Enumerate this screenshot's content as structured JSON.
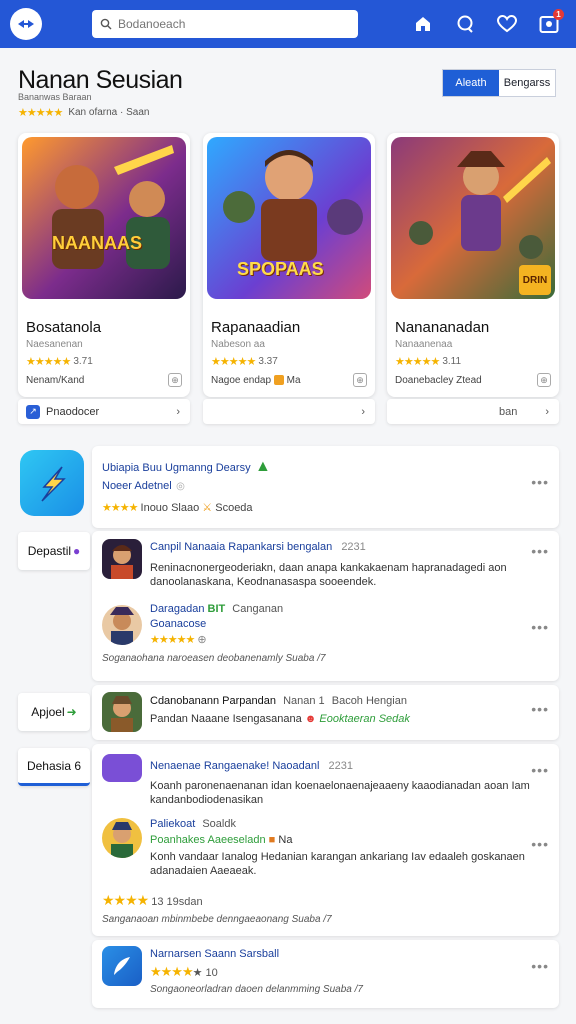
{
  "topbar": {
    "search_placeholder": "Bodanoeach",
    "notification_count": "1",
    "colors": {
      "bar": "#2457d6"
    }
  },
  "header": {
    "title": "Nanan Seusian",
    "subtitle": "Bananwas Baraan",
    "rating_text": "Kan ofarna · Saan",
    "toggle": {
      "active": "Aleath",
      "inactive": "Bengarss"
    }
  },
  "cards": [
    {
      "art_text": "NAANAAS",
      "title": "Bosatanola",
      "subtitle": "Naesanenan",
      "rating": "3.71",
      "meta": "Nenam/Kand",
      "stars": 4.5
    },
    {
      "art_text": "SPOPAAS",
      "title": "Rapanaadian",
      "subtitle": "Nabeson aa",
      "rating": "3.37",
      "meta": "Nagoe endap",
      "meta_extra": "Ma",
      "stars": 4.5
    },
    {
      "art_text": "DRIN",
      "title": "Nanananadan",
      "subtitle": "Nanaanenaa",
      "rating": "3.11",
      "meta": "Doanebacley Ztead",
      "stars": 4.5
    }
  ],
  "card_footers": [
    {
      "label": "Pnaodocer"
    },
    {
      "label": "ban"
    },
    {
      "label": ""
    }
  ],
  "side_labels": {
    "first": "Depastil",
    "second": "Apjoel",
    "third": "Dehasia 6"
  },
  "featured": {
    "line1": "Ubiapia Buu Ugmanng Dearsy",
    "line2": "Noeer Adetnel",
    "rating_text": "Inouo Slaao",
    "extra": "Scoeda"
  },
  "threads": [
    {
      "header": "Canpil Nanaaia Rapankarsi bengalan",
      "time": "2231",
      "body": "Reninacnonergeoderiakn, daan anapa kankakaenam hapranadagedi aon danoolanaskana, Keodnanasaspa sooeendek.",
      "reply_name": "Daragadan",
      "reply_tag": "BIT",
      "reply_meta": "Canganan",
      "reply_sub": "Goanacose",
      "footer": "Soganaohana naroeasen deobanenamly Suaba /7"
    },
    {
      "header": "Cdanobanann Parpandan",
      "tag": "Nanan 1",
      "sub_tag": "Bacoh Hengian",
      "body": "Pandan Naaane Isengasanana",
      "extra": "Eooktaeran Sedak"
    },
    {
      "header": "Nenaenae Rangaenake! Naoadanl",
      "time": "2231",
      "body": "Koanh paronenaenanan idan koenaelonaenajeaaeny kaaodianadan aoan Iam kandanbodiodenasikan",
      "reply_name": "Paliekoat",
      "reply_meta": "Soaldk",
      "reply_sub": "Poanhakes Aaeeseladn",
      "reply_extra": "Na",
      "reply_body": "Konh vandaar Ianalog Hedanian karangan ankariang Iav edaaleh goskanaen adanadaien Aaeaeak.",
      "rating_text": "13 19sdan",
      "footer": "Sanganaoan mbinmbebe denngaeaonang Suaba /7"
    },
    {
      "header": "Narnarsen Saann Sarsball",
      "rating_text": "10",
      "footer": "Songaoneorladran daoen delanmming Suaba /7"
    }
  ]
}
